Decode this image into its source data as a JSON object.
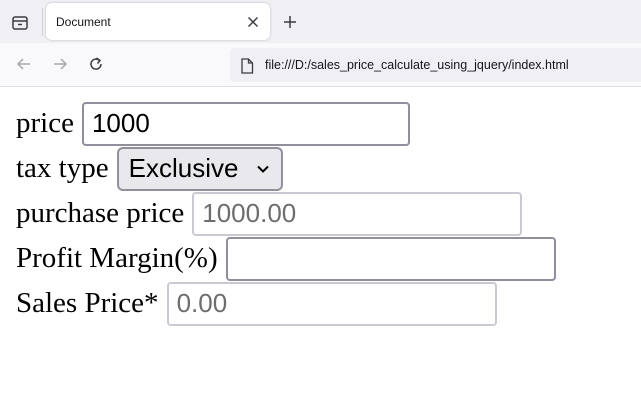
{
  "browser": {
    "tab": {
      "title": "Document",
      "close_icon": "close-icon"
    },
    "new_tab_icon": "plus-icon",
    "tab_list_icon": "tab-list-icon",
    "nav": {
      "back_icon": "arrow-left-icon",
      "forward_icon": "arrow-right-icon",
      "reload_icon": "reload-icon"
    },
    "url": "file:///D:/sales_price_calculate_using_jquery/index.html"
  },
  "form": {
    "price": {
      "label": "price",
      "value": "1000"
    },
    "tax_type": {
      "label": "tax type",
      "selected": "Exclusive"
    },
    "purchase_price": {
      "label": "purchase price",
      "value": "1000.00"
    },
    "profit_margin": {
      "label": "Profit Margin(%)",
      "value": ""
    },
    "sales_price": {
      "label": "Sales Price*",
      "value": "0.00"
    }
  }
}
